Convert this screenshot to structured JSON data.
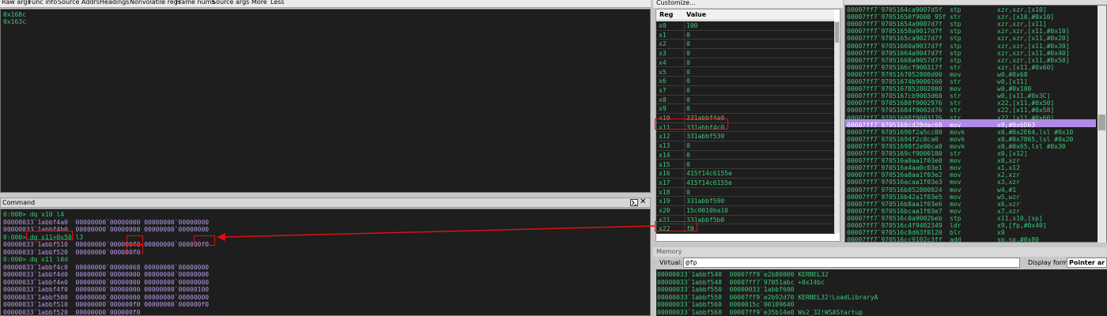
{
  "stack_toolbar": {
    "items": [
      "Raw args",
      "Func info",
      "Source",
      "Addrs",
      "Headings",
      "Nonvolatile regs",
      "Frame nums",
      "Source args",
      "More",
      "Less"
    ]
  },
  "stack_pane": {
    "lines": [
      "0x168c",
      "0x163c"
    ]
  },
  "command": {
    "title": "Command",
    "lines": [
      {
        "text": "0:000> dq x10 l4",
        "color": "green"
      },
      {
        "text": "00000033`1abbf4a0  00000000`00000000 00000000`00000000",
        "color": "purple"
      },
      {
        "text": "00000033`1abbf4b0  00000000`00000000 00000000`00000000",
        "color": "purple"
      },
      {
        "text": "0:000> dq x11+0x50 l3",
        "color": "green"
      },
      {
        "text": "00000033`1abbf510  00000000`000000f0 00000000`000000f0",
        "color": "purple"
      },
      {
        "text": "00000033`1abbf520  00000000`000000f0",
        "color": "purple"
      },
      {
        "text": "0:000> dq x11 l0d",
        "color": "green"
      },
      {
        "text": "00000033`1abbf4c0  00000000`00000068 00000000`00000000",
        "color": "purple"
      },
      {
        "text": "00000033`1abbf4d0  00000000`00000000 00000000`00000000",
        "color": "purple"
      },
      {
        "text": "00000033`1abbf4e0  00000000`00000000 00000000`00000000",
        "color": "purple"
      },
      {
        "text": "00000033`1abbf4f0  00000000`00000000 00000000`00000100",
        "color": "purple"
      },
      {
        "text": "00000033`1abbf500  00000000`00000000 00000000`00000000",
        "color": "purple"
      },
      {
        "text": "00000033`1abbf510  00000000`000000f0 00000000`000000f0",
        "color": "purple"
      },
      {
        "text": "00000033`1abbf520  00000000`000000f0",
        "color": "purple"
      }
    ]
  },
  "registers": {
    "customize_label": "Customize...",
    "col_reg": "Reg",
    "col_value": "Value",
    "rows": [
      {
        "reg": "x0",
        "value": "100"
      },
      {
        "reg": "x1",
        "value": "0"
      },
      {
        "reg": "x2",
        "value": "0"
      },
      {
        "reg": "x3",
        "value": "0"
      },
      {
        "reg": "x4",
        "value": "0"
      },
      {
        "reg": "x5",
        "value": "0"
      },
      {
        "reg": "x6",
        "value": "0"
      },
      {
        "reg": "x7",
        "value": "0"
      },
      {
        "reg": "x8",
        "value": "0"
      },
      {
        "reg": "x9",
        "value": "0"
      },
      {
        "reg": "x10",
        "value": "331abbf4a0"
      },
      {
        "reg": "x11",
        "value": "331abbf4c0"
      },
      {
        "reg": "x12",
        "value": "331abbf530"
      },
      {
        "reg": "x13",
        "value": "0"
      },
      {
        "reg": "x14",
        "value": "0"
      },
      {
        "reg": "x15",
        "value": "0"
      },
      {
        "reg": "x16",
        "value": "415f14c6155e"
      },
      {
        "reg": "x17",
        "value": "415f14c6155e"
      },
      {
        "reg": "x18",
        "value": "0"
      },
      {
        "reg": "x19",
        "value": "331abbf590"
      },
      {
        "reg": "x20",
        "value": "15c0010ba10"
      },
      {
        "reg": "x21",
        "value": "331abbf5b0"
      },
      {
        "reg": "x22",
        "value": "f0"
      }
    ]
  },
  "disassembly": {
    "lines": [
      {
        "addr": "00007ff7`9705164c",
        "bytes": "a9007d5f",
        "op": "stp",
        "args": "xzr,xzr,[x10]"
      },
      {
        "addr": "00007ff7`97051650",
        "bytes": "f9000 95f",
        "op": "str",
        "args": "xzr,[x10,#0x10]"
      },
      {
        "addr": "00007ff7`97051654",
        "bytes": "a9007d7f",
        "op": "stp",
        "args": "xzr,xzr,[x11]"
      },
      {
        "addr": "00007ff7`97051658",
        "bytes": "a9017d7f",
        "op": "stp",
        "args": "xzr,xzr,[x11,#0x10]"
      },
      {
        "addr": "00007ff7`9705165c",
        "bytes": "a9027d7f",
        "op": "stp",
        "args": "xzr,xzr,[x11,#0x20]"
      },
      {
        "addr": "00007ff7`97051660",
        "bytes": "a9037d7f",
        "op": "stp",
        "args": "xzr,xzr,[x11,#0x30]"
      },
      {
        "addr": "00007ff7`97051664",
        "bytes": "a9047d7f",
        "op": "stp",
        "args": "xzr,xzr,[x11,#0x40]"
      },
      {
        "addr": "00007ff7`97051668",
        "bytes": "a9057d7f",
        "op": "stp",
        "args": "xzr,xzr,[x11,#0x50]"
      },
      {
        "addr": "00007ff7`9705166c",
        "bytes": "f900317f",
        "op": "str",
        "args": "xzr,[x11,#0x60]"
      },
      {
        "addr": "00007ff7`97051670",
        "bytes": "52800d00",
        "op": "mov",
        "args": "w0,#0x68"
      },
      {
        "addr": "00007ff7`97051674",
        "bytes": "b9000160",
        "op": "str",
        "args": "w0,[x11]"
      },
      {
        "addr": "00007ff7`97051678",
        "bytes": "52802000",
        "op": "mov",
        "args": "w0,#0x100"
      },
      {
        "addr": "00007ff7`9705167c",
        "bytes": "b9003d60",
        "op": "str",
        "args": "w0,[x11,#0x3C]"
      },
      {
        "addr": "00007ff7`97051680",
        "bytes": "f9002976",
        "op": "str",
        "args": "x22,[x11,#0x50]"
      },
      {
        "addr": "00007ff7`97051684",
        "bytes": "f9002d76",
        "op": "str",
        "args": "x22,[x11,#0x58]"
      },
      {
        "addr": "00007ff7`97051688",
        "bytes": "f9003176",
        "op": "str",
        "args": "x22,[x11,#0x60]"
      },
      {
        "addr": "00007ff7`9705168c",
        "bytes": "d28dac60",
        "op": "mov",
        "args": "x0,#0x6D63"
      },
      {
        "addr": "00007ff7`97051690",
        "bytes": "f2a5cc80",
        "op": "movk",
        "args": "x0,#0x2E64,lsl #0x10"
      },
      {
        "addr": "00007ff7`97051694",
        "bytes": "f2c0ca0",
        "op": "movk",
        "args": "x0,#0x7865,lsl #0x20"
      },
      {
        "addr": "00007ff7`97051698",
        "bytes": "f2e00ca0",
        "op": "movk",
        "args": "x0,#0x65,lsl #0x30"
      },
      {
        "addr": "00007ff7`9705169c",
        "bytes": "f9000180",
        "op": "str",
        "args": "x0,[x12]"
      },
      {
        "addr": "00007ff7`970516a0",
        "bytes": "aa1f03e0",
        "op": "mov",
        "args": "x0,xzr"
      },
      {
        "addr": "00007ff7`970516a4",
        "bytes": "aa0c03e1",
        "op": "mov",
        "args": "x1,x12"
      },
      {
        "addr": "00007ff7`970516a8",
        "bytes": "aa1f03e2",
        "op": "mov",
        "args": "x2,xzr"
      },
      {
        "addr": "00007ff7`970516ac",
        "bytes": "aa1f03e3",
        "op": "mov",
        "args": "x3,xzr"
      },
      {
        "addr": "00007ff7`970516b0",
        "bytes": "52800024",
        "op": "mov",
        "args": "w4,#1"
      },
      {
        "addr": "00007ff7`970516b4",
        "bytes": "2a1f03e5",
        "op": "mov",
        "args": "w5,wzr"
      },
      {
        "addr": "00007ff7`970516b8",
        "bytes": "aa1f03e6",
        "op": "mov",
        "args": "x6,xzr"
      },
      {
        "addr": "00007ff7`970516bc",
        "bytes": "aa1f03e7",
        "op": "mov",
        "args": "x7,xzr"
      },
      {
        "addr": "00007ff7`970516c0",
        "bytes": "a9002beb",
        "op": "stp",
        "args": "x11,x10,[sp]"
      },
      {
        "addr": "00007ff7`970516c4",
        "bytes": "f9402349",
        "op": "ldr",
        "args": "x9,[fp,#0x40]"
      },
      {
        "addr": "00007ff7`970516c8",
        "bytes": "d63f0120",
        "op": "blr",
        "args": "x9"
      },
      {
        "addr": "00007ff7`970516cc",
        "bytes": "9102c3ff",
        "op": "add",
        "args": "sp,sp,#0x80"
      }
    ],
    "highlight_index": 16
  },
  "memory": {
    "title": "Memory",
    "virtual_label": "Virtual:",
    "virtual_value": "@fp",
    "format_label": "Display format:",
    "format_value": "Pointer ar",
    "lines": [
      "00000033`1abbf540  00007ff9`e2b80000 KERNEL32",
      "00000033`1abbf548  00007ff7`97051abc +0x14bc",
      "00000033`1abbf550  00000033`1abbf600",
      "00000033`1abbf558  00007ff9`e2b92d70 KERNEL32!LoadLibraryA",
      "00000033`1abbf560  0000015c`00109640",
      "00000033`1abbf568  00007ff9`e35b14e0 Ws2_32!WSAStartup"
    ]
  },
  "colors": {
    "green_text": "#3cc878",
    "purple_text": "#b79aea",
    "pane_bg": "#1e1e1e",
    "annotation_red": "#e01010",
    "highlight": "#b08ae6"
  }
}
